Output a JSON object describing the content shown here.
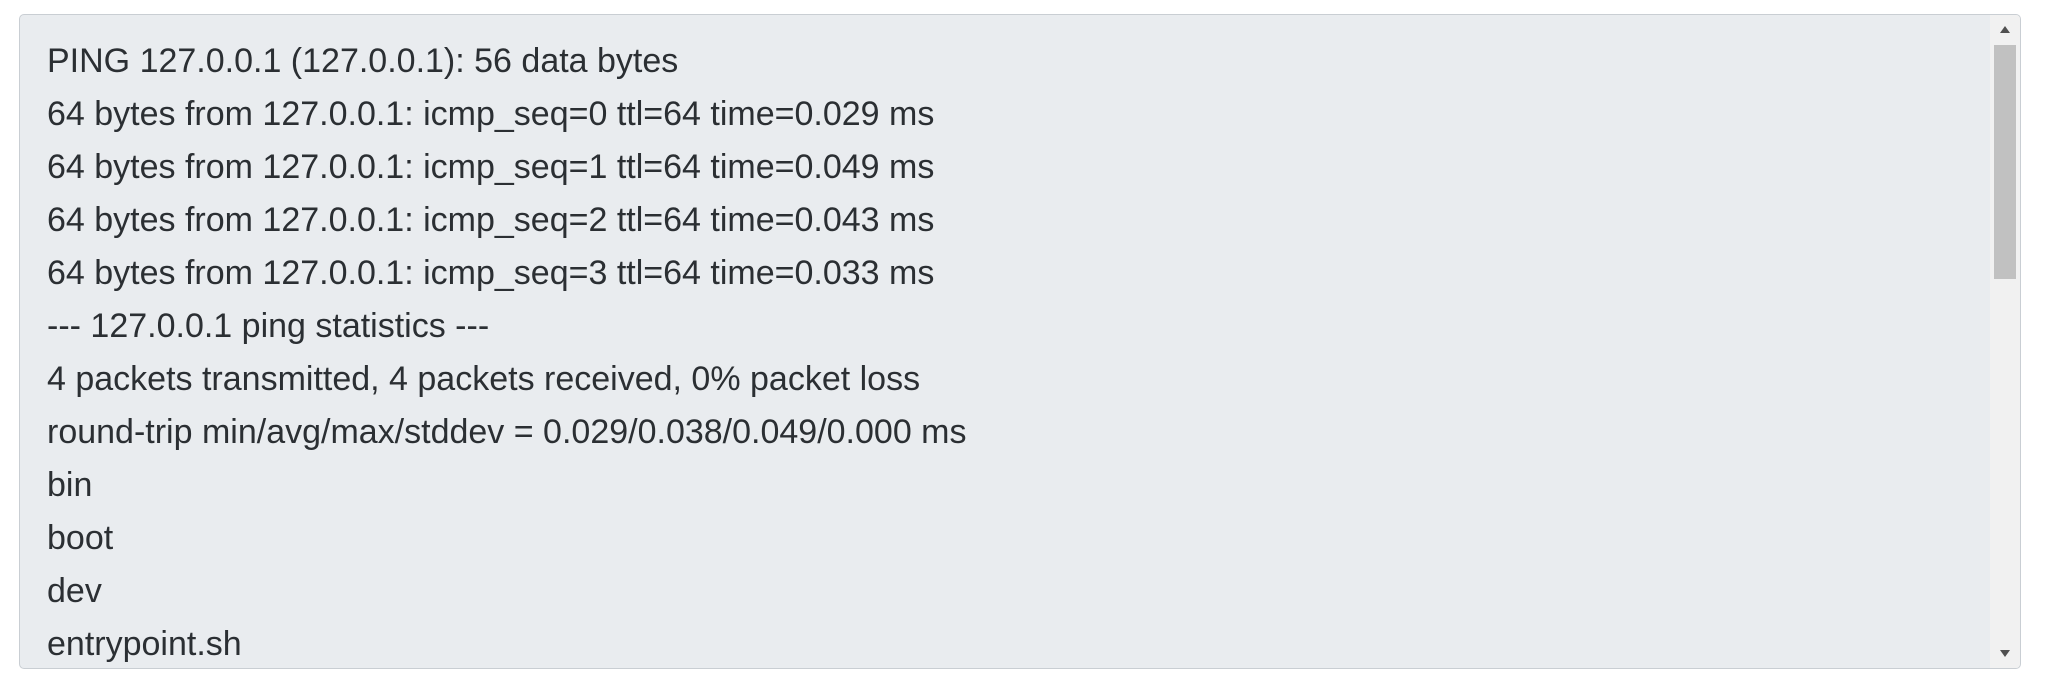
{
  "output": {
    "lines": [
      "PING 127.0.0.1 (127.0.0.1): 56 data bytes",
      "64 bytes from 127.0.0.1: icmp_seq=0 ttl=64 time=0.029 ms",
      "64 bytes from 127.0.0.1: icmp_seq=1 ttl=64 time=0.049 ms",
      "64 bytes from 127.0.0.1: icmp_seq=2 ttl=64 time=0.043 ms",
      "64 bytes from 127.0.0.1: icmp_seq=3 ttl=64 time=0.033 ms",
      "--- 127.0.0.1 ping statistics ---",
      "4 packets transmitted, 4 packets received, 0% packet loss",
      "round-trip min/avg/max/stddev = 0.029/0.038/0.049/0.000 ms",
      "bin",
      "boot",
      "dev",
      "entrypoint.sh"
    ]
  },
  "scrollbar": {
    "up_icon": "triangle-up-icon",
    "down_icon": "triangle-down-icon",
    "position_fraction": 0.0
  },
  "colors": {
    "background": "#e9ecef",
    "text": "#2b2f33",
    "border": "#c9ced3"
  }
}
